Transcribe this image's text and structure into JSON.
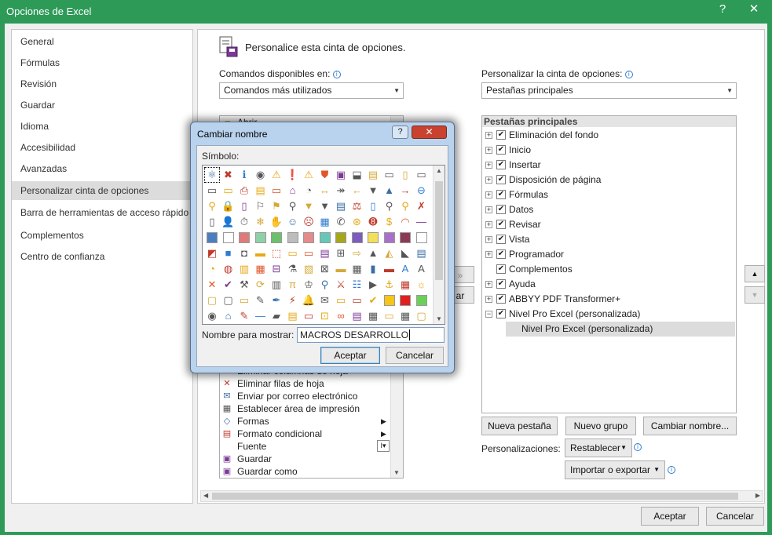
{
  "window": {
    "title": "Opciones de Excel",
    "help": "?",
    "close": "✕",
    "accent": "#2d9a57"
  },
  "nav": {
    "items": [
      {
        "label": "General",
        "selected": false
      },
      {
        "label": "Fórmulas",
        "selected": false
      },
      {
        "label": "Revisión",
        "selected": false
      },
      {
        "label": "Guardar",
        "selected": false
      },
      {
        "label": "Idioma",
        "selected": false
      },
      {
        "label": "Accesibilidad",
        "selected": false
      },
      {
        "label": "Avanzadas",
        "selected": false
      },
      {
        "label": "Personalizar cinta de opciones",
        "selected": true
      },
      {
        "label": "Barra de herramientas de acceso rápido",
        "selected": false
      },
      {
        "label": "Complementos",
        "selected": false
      },
      {
        "label": "Centro de confianza",
        "selected": false
      }
    ]
  },
  "main": {
    "heading": "Personalice esta cinta de opciones.",
    "commands_label": "Comandos disponibles en:",
    "commands_value": "Comandos más utilizados",
    "ribbon_label": "Personalizar la cinta de opciones:",
    "ribbon_value": "Pestañas principales",
    "commands_list": [
      {
        "icon": "delete-cols-icon",
        "label": "Eliminar columnas de hoja",
        "submenu": false
      },
      {
        "icon": "delete-rows-icon",
        "label": "Eliminar filas de hoja",
        "submenu": false
      },
      {
        "icon": "email-icon",
        "label": "Enviar por correo electrónico",
        "submenu": false
      },
      {
        "icon": "print-area-icon",
        "label": "Establecer área de impresión",
        "submenu": false
      },
      {
        "icon": "shapes-icon",
        "label": "Formas",
        "submenu": true
      },
      {
        "icon": "conditional-format-icon",
        "label": "Formato condicional",
        "submenu": true
      },
      {
        "icon": "font-icon",
        "label": "Fuente",
        "submenu": false
      },
      {
        "icon": "save-icon",
        "label": "Guardar",
        "submenu": false
      },
      {
        "icon": "save-as-icon",
        "label": "Guardar como",
        "submenu": false
      }
    ],
    "commands_partial_top": "Abrir",
    "add_partial": "»",
    "remove_partial": "ar",
    "tree_header": "Pestañas principales",
    "tree": [
      {
        "label": "Eliminación del fondo",
        "checked": true,
        "expanded": false
      },
      {
        "label": "Inicio",
        "checked": true,
        "expanded": false
      },
      {
        "label": "Insertar",
        "checked": true,
        "expanded": false
      },
      {
        "label": "Disposición de página",
        "checked": true,
        "expanded": false
      },
      {
        "label": "Fórmulas",
        "checked": true,
        "expanded": false
      },
      {
        "label": "Datos",
        "checked": true,
        "expanded": false
      },
      {
        "label": "Revisar",
        "checked": true,
        "expanded": false
      },
      {
        "label": "Vista",
        "checked": true,
        "expanded": false
      },
      {
        "label": "Programador",
        "checked": true,
        "expanded": false
      },
      {
        "label": "Complementos",
        "checked": true,
        "expanded": null
      },
      {
        "label": "Ayuda",
        "checked": true,
        "expanded": false
      },
      {
        "label": "ABBYY PDF Transformer+",
        "checked": true,
        "expanded": false
      },
      {
        "label": "Nivel Pro Excel (personalizada)",
        "checked": true,
        "expanded": true
      }
    ],
    "tree_child": "Nivel Pro Excel (personalizada)",
    "btn_new_tab": "Nueva pestaña",
    "btn_new_group": "Nuevo grupo",
    "btn_rename": "Cambiar nombre...",
    "customizations_label": "Personalizaciones:",
    "reset": "Restablecer",
    "import_export": "Importar o exportar",
    "ok": "Aceptar",
    "cancel": "Cancelar"
  },
  "dialog": {
    "title": "Cambiar nombre",
    "help": "?",
    "close": "✕",
    "symbol_label": "Símbolo:",
    "name_label": "Nombre para mostrar:",
    "name_value": "MACROS DESARROLLO",
    "ok": "Aceptar",
    "cancel": "Cancelar",
    "symbols": [
      [
        "⚛",
        "✖",
        "ℹ",
        "◉",
        "⚠",
        "❗",
        "⚠",
        "⛊",
        "▣",
        "⬓",
        "▤",
        "▭",
        "▯",
        "▭"
      ],
      [
        "▭",
        "▭",
        "⎙",
        "▤",
        "▭",
        "⌂",
        "◔",
        "↔",
        "↠",
        "←",
        "▼",
        "▲",
        "→",
        "⊖"
      ],
      [
        "⚲",
        "🔒",
        "▯",
        "⚐",
        "⚑",
        "⚲",
        "▼",
        "▼",
        "▤",
        "⚖",
        "▯",
        "⚲",
        "⚲",
        "✗"
      ],
      [
        "▯",
        "👤",
        "⏱",
        "❄",
        "✋",
        "☺",
        "☹",
        "▦",
        "✆",
        "⊛",
        "➑",
        "$",
        "◠",
        "—"
      ],
      [
        "#4a7ebf",
        "#ffffff",
        "#e07a7a",
        "#8fd0a8",
        "#6cc06c",
        "#bdbdbd",
        "#e58b8b",
        "#66c7b8",
        "#a6a61b",
        "#7c5cbc",
        "#f3e05a",
        "#a970c9",
        "#8b3a56",
        "#ffffff"
      ],
      [
        "◩",
        "■",
        "◘",
        "▬",
        "⬚",
        "▭",
        "▭",
        "▤",
        "⊞",
        "⇨",
        "▲",
        "◭",
        "◣",
        "▤"
      ],
      [
        "◔",
        "◍",
        "▥",
        "▦",
        "⊟",
        "⚗",
        "▧",
        "⊠",
        "▬",
        "▦",
        "▮",
        "▬",
        "A",
        "A"
      ],
      [
        "✕",
        "✔",
        "⚒",
        "⟳",
        "▥",
        "π",
        "♔",
        "⚲",
        "⚔",
        "☷",
        "▶",
        "⚓",
        "▦",
        "☼"
      ],
      [
        "▢",
        "▢",
        "▭",
        "✎",
        "✒",
        "⚡",
        "🔔",
        "✉",
        "▭",
        "▭",
        "✔",
        "#f5c518",
        "#e02020",
        "#6bd05a"
      ],
      [
        "◉",
        "⌂",
        "✎",
        "—",
        "▰",
        "▤",
        "▭",
        "⊡",
        "∞",
        "▤",
        "▦",
        "▭",
        "▦",
        "▢"
      ]
    ]
  }
}
